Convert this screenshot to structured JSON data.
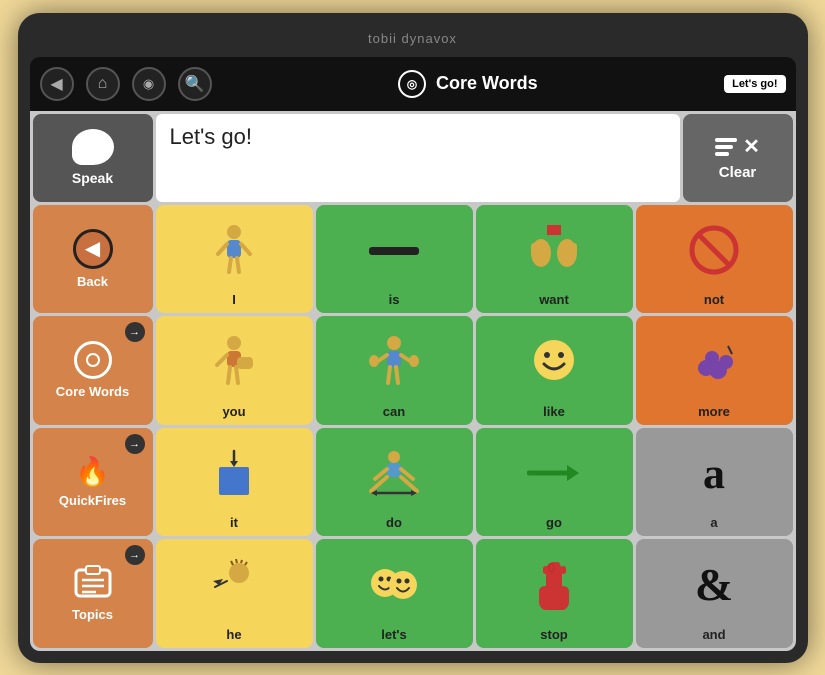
{
  "brand": "tobii dynavox",
  "nav": {
    "back_icon": "◀",
    "home_icon": "⌂",
    "profile_icon": "◎",
    "search_icon": "🔍",
    "title": "Core Words",
    "lets_go_label": "Let's go!"
  },
  "top_row": {
    "speak_label": "Speak",
    "text_content": "Let's go!",
    "clear_label": "Clear"
  },
  "left_column": [
    {
      "label": "Back",
      "type": "back",
      "has_badge": false
    },
    {
      "label": "Core Words",
      "type": "corewords",
      "has_badge": true
    },
    {
      "label": "QuickFires",
      "type": "quickfires",
      "has_badge": true
    },
    {
      "label": "Topics",
      "type": "topics",
      "has_badge": true
    }
  ],
  "grid": [
    [
      {
        "label": "I",
        "color": "yellow",
        "emoji": "🧍"
      },
      {
        "label": "is",
        "color": "green",
        "emoji": "➖"
      },
      {
        "label": "want",
        "color": "green",
        "emoji": "🙌"
      },
      {
        "label": "not",
        "color": "orange",
        "emoji": "🚫"
      }
    ],
    [
      {
        "label": "you",
        "color": "yellow",
        "emoji": "🤜"
      },
      {
        "label": "can",
        "color": "green",
        "emoji": "💪"
      },
      {
        "label": "like",
        "color": "green",
        "emoji": "😊"
      },
      {
        "label": "more",
        "color": "orange",
        "emoji": "🫐"
      }
    ],
    [
      {
        "label": "it",
        "color": "yellow",
        "emoji": "🟦"
      },
      {
        "label": "do",
        "color": "green",
        "emoji": "↔️"
      },
      {
        "label": "go",
        "color": "green",
        "emoji": "➡️"
      },
      {
        "label": "a",
        "color": "dark-gray",
        "emoji": ""
      }
    ],
    [
      {
        "label": "he",
        "color": "yellow",
        "emoji": "👤"
      },
      {
        "label": "let's",
        "color": "green",
        "emoji": "😄"
      },
      {
        "label": "stop",
        "color": "green",
        "emoji": "✋"
      },
      {
        "label": "and",
        "color": "dark-gray",
        "emoji": ""
      }
    ]
  ]
}
